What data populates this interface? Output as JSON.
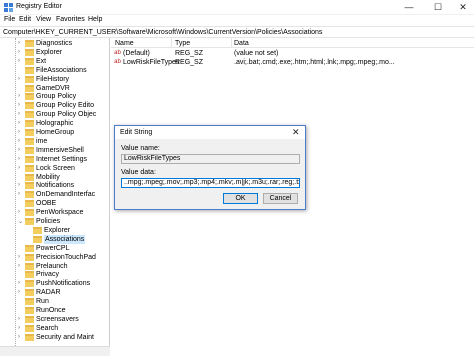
{
  "window": {
    "title": "Registry Editor",
    "minimize_glyph": "—",
    "maximize_glyph": "☐",
    "close_glyph": "✕"
  },
  "menu": [
    "File",
    "Edit",
    "View",
    "Favorites",
    "Help"
  ],
  "address": "Computer\\HKEY_CURRENT_USER\\Software\\Microsoft\\Windows\\CurrentVersion\\Policies\\Associations",
  "tree": {
    "items": [
      {
        "label": "Diagnostics",
        "expander": "›"
      },
      {
        "label": "Explorer",
        "expander": "›"
      },
      {
        "label": "Ext",
        "expander": "›"
      },
      {
        "label": "FileAssociations",
        "expander": ""
      },
      {
        "label": "FileHistory",
        "expander": "›"
      },
      {
        "label": "GameDVR",
        "expander": ""
      },
      {
        "label": "Group Policy",
        "expander": "›"
      },
      {
        "label": "Group Policy Edito",
        "expander": "›"
      },
      {
        "label": "Group Policy Objec",
        "expander": "›"
      },
      {
        "label": "Holographic",
        "expander": "›"
      },
      {
        "label": "HomeGroup",
        "expander": "›"
      },
      {
        "label": "ime",
        "expander": "›"
      },
      {
        "label": "ImmersiveShell",
        "expander": "›"
      },
      {
        "label": "Internet Settings",
        "expander": "›"
      },
      {
        "label": "Lock Screen",
        "expander": "›"
      },
      {
        "label": "Mobility",
        "expander": ""
      },
      {
        "label": "Notifications",
        "expander": "›"
      },
      {
        "label": "OnDemandInterfac",
        "expander": "›"
      },
      {
        "label": "OOBE",
        "expander": ""
      },
      {
        "label": "PenWorkspace",
        "expander": "›"
      },
      {
        "label": "Policies",
        "expander": "⌄"
      },
      {
        "label": "Explorer",
        "expander": "",
        "indent": 1
      },
      {
        "label": "Associations",
        "expander": "",
        "indent": 1,
        "selected": true
      },
      {
        "label": "PowerCPL",
        "expander": ""
      },
      {
        "label": "PrecisionTouchPad",
        "expander": "›"
      },
      {
        "label": "Prelaunch",
        "expander": "›"
      },
      {
        "label": "Privacy",
        "expander": ""
      },
      {
        "label": "PushNotifications",
        "expander": "›"
      },
      {
        "label": "RADAR",
        "expander": "›"
      },
      {
        "label": "Run",
        "expander": ""
      },
      {
        "label": "RunOnce",
        "expander": ""
      },
      {
        "label": "Screensavers",
        "expander": "›"
      },
      {
        "label": "Search",
        "expander": "›"
      },
      {
        "label": "Security and Maint",
        "expander": "›"
      }
    ]
  },
  "list": {
    "headers": {
      "name": "Name",
      "type": "Type",
      "data": "Data"
    },
    "rows": [
      {
        "icon": "ab",
        "icon_kind": "string",
        "name": "(Default)",
        "type": "REG_SZ",
        "data": "(value not set)"
      },
      {
        "icon": "ab",
        "icon_kind": "string",
        "name": "LowRiskFileTypes",
        "type": "REG_SZ",
        "data": ".avi;.bat;.cmd;.exe;.htm;.html;.lnk;.mpg;.mpeg;.mo..."
      }
    ]
  },
  "dialog": {
    "title": "Edit String",
    "close_glyph": "✕",
    "value_name_label": "Value name:",
    "value_name": "LowRiskFileTypes",
    "value_data_label": "Value data:",
    "value_data": "..mpg;.mpeg;.mov;.mp3;.mp4;.mkv;.m|jk;.m3u;.rar;.reg;.txt;.vbs;.wav;.zip;.?z",
    "ok_label": "OK",
    "cancel_label": "Cancel"
  },
  "colors": {
    "selection": "#cce8ff",
    "accent": "#0078d7",
    "folder": "#f3cd5e"
  }
}
